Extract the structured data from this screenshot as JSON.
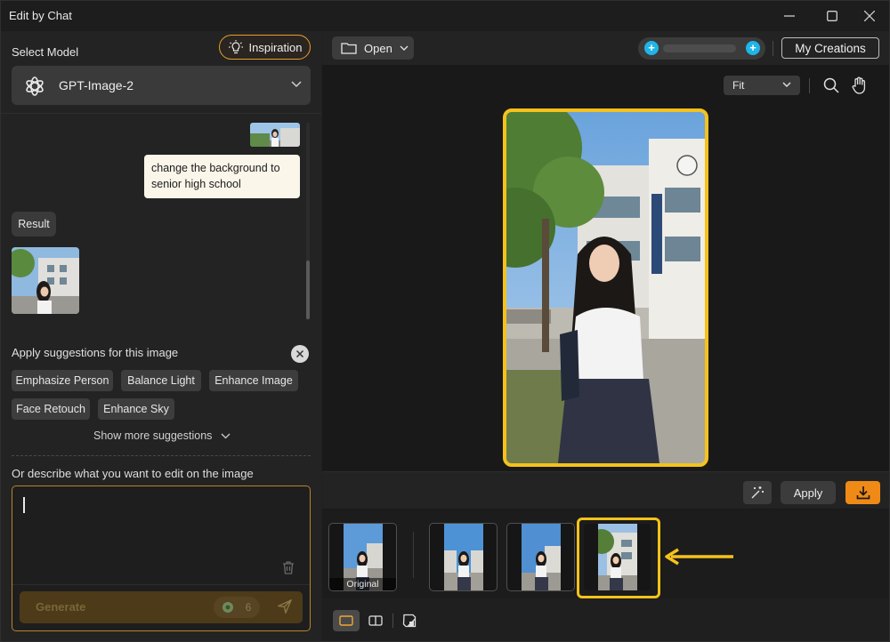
{
  "window": {
    "title": "Edit by Chat",
    "controls": {
      "minimize": "minimize-icon",
      "maximize": "maximize-icon",
      "close": "close-icon"
    }
  },
  "left_panel": {
    "select_model_label": "Select Model",
    "inspiration_label": "Inspiration",
    "model": {
      "name": "GPT-Image-2",
      "icon": "openai-logo-icon"
    },
    "chat": {
      "user_message": "change the background to senior high school",
      "result_label": "Result"
    },
    "suggestions": {
      "title": "Apply suggestions for this image",
      "chips": [
        "Emphasize Person",
        "Balance Light",
        "Enhance Image",
        "Face Retouch",
        "Enhance Sky"
      ],
      "show_more": "Show more suggestions"
    },
    "describe_label": "Or describe what you want to edit on the image",
    "prompt": {
      "value": ""
    },
    "generate": {
      "label": "Generate",
      "credits": "6"
    }
  },
  "right_panel": {
    "toolbar": {
      "open_label": "Open",
      "my_creations_label": "My Creations"
    },
    "canvas": {
      "zoom_mode": "Fit"
    },
    "actions": {
      "apply_label": "Apply"
    },
    "filmstrip": {
      "original_caption": "Original"
    }
  },
  "colors": {
    "accent": "#f5c21b",
    "download": "#f08a16",
    "inspiration_border": "#e6a02a",
    "credit_plus": "#1fb5e8"
  }
}
